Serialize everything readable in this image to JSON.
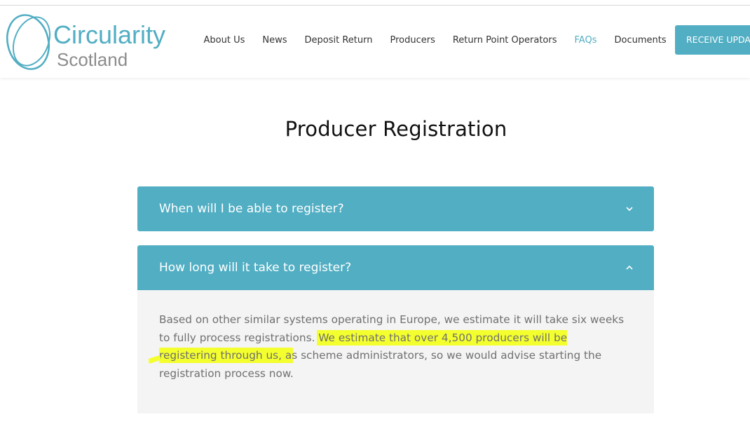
{
  "logo": {
    "line1": "Circularity",
    "line2": "Scotland"
  },
  "nav": {
    "items": [
      {
        "label": "About Us",
        "active": false
      },
      {
        "label": "News",
        "active": false
      },
      {
        "label": "Deposit Return",
        "active": false
      },
      {
        "label": "Producers",
        "active": false
      },
      {
        "label": "Return Point Operators",
        "active": false
      },
      {
        "label": "FAQs",
        "active": true
      },
      {
        "label": "Documents",
        "active": false
      }
    ],
    "cta_label": "RECEIVE UPDATES"
  },
  "page": {
    "title": "Producer Registration"
  },
  "faqs": [
    {
      "question": "When will I be able to register?",
      "expanded": false,
      "icon": "chevron-down-icon"
    },
    {
      "question": "How long will it take to register?",
      "expanded": true,
      "icon": "chevron-up-icon",
      "answer_part1": "Based on other similar systems operating in Europe, we estimate it will take six weeks to fully process registrations.  ",
      "answer_highlight": "We estimate that over 4,500 producers will be registering through us, a",
      "answer_part2": "s scheme administrators, so we would advise starting the registration process now."
    }
  ],
  "colors": {
    "brand": "#52aec3",
    "highlight": "#f4ff2e",
    "body_text": "#707070",
    "panel_bg": "#f4f4f4"
  }
}
